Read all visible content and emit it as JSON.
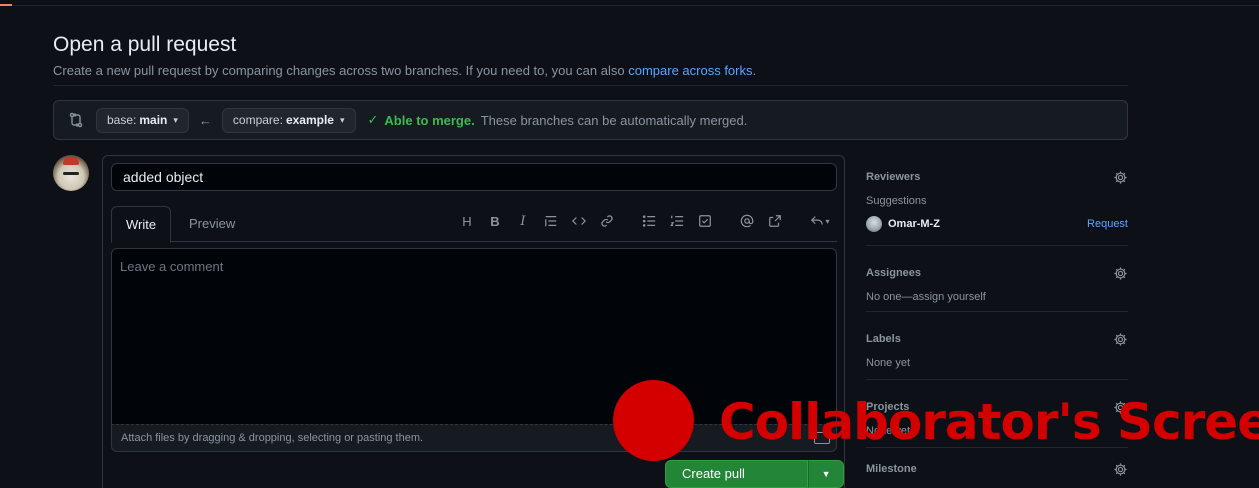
{
  "header": {
    "title": "Open a pull request",
    "subtitle": "Create a new pull request by comparing changes across two branches. If you need to, you can also",
    "subtitle_link": "compare across forks",
    "subtitle_end": "."
  },
  "range": {
    "base_prefix": "base:",
    "base_branch": "main",
    "compare_prefix": "compare:",
    "compare_branch": "example",
    "merge_status": "Able to merge.",
    "merge_desc": "These branches can be automatically merged."
  },
  "form": {
    "title_value": "added object",
    "tabs": {
      "write": "Write",
      "preview": "Preview"
    },
    "comment_placeholder": "Leave a comment",
    "attach_hint": "Attach files by dragging & dropping, selecting or pasting them.",
    "create_label": "Create pull request"
  },
  "toolbar": {
    "heading": "H",
    "bold": "B",
    "italic": "I"
  },
  "sidebar": {
    "reviewers": {
      "title": "Reviewers",
      "suggestions": "Suggestions",
      "user": "Omar-M-Z",
      "request": "Request"
    },
    "assignees": {
      "title": "Assignees",
      "text": "No one—assign yourself"
    },
    "labels": {
      "title": "Labels",
      "text": "None yet"
    },
    "projects": {
      "title": "Projects",
      "text": "None yet"
    },
    "milestone": {
      "title": "Milestone"
    }
  },
  "overlay": {
    "label": "Collaborator's Screen",
    "color": "#d40000"
  },
  "colors": {
    "background": "#0d1117",
    "link": "#58a6ff",
    "success": "#3fb950",
    "button": "#238636"
  }
}
